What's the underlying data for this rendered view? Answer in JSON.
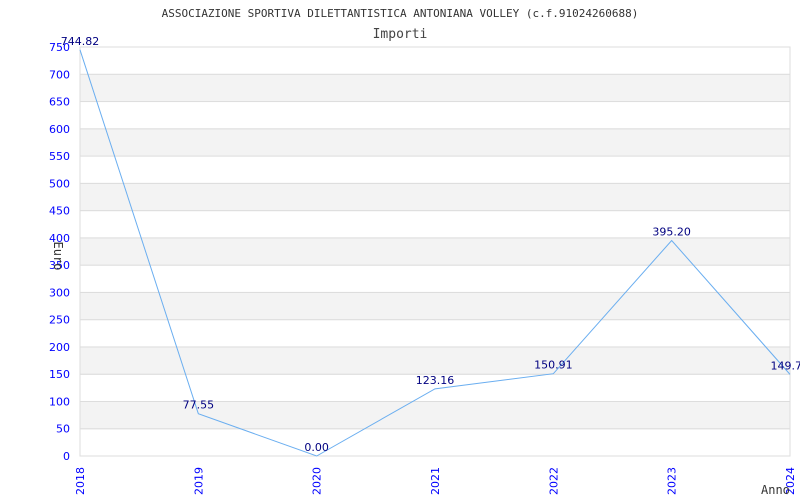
{
  "chart_data": {
    "type": "line",
    "title": "ASSOCIAZIONE SPORTIVA DILETTANTISTICA ANTONIANA VOLLEY (c.f.91024260688)",
    "subtitle": "Importi",
    "xlabel": "Anno",
    "ylabel": "Euro",
    "categories": [
      "2018",
      "2019",
      "2020",
      "2021",
      "2022",
      "2023",
      "2024"
    ],
    "values": [
      744.82,
      77.55,
      0.0,
      123.16,
      150.91,
      395.2,
      149.7
    ],
    "data_labels": [
      "744.82",
      "77.55",
      "0.00",
      "123.16",
      "150.91",
      "395.20",
      "149.7"
    ],
    "ylim": [
      0,
      750
    ],
    "yticks": [
      0,
      50,
      100,
      150,
      200,
      250,
      300,
      350,
      400,
      450,
      500,
      550,
      600,
      650,
      700,
      750
    ],
    "grid": true,
    "colors": {
      "line": "#6aaef0",
      "tick_labels": "#0000ff",
      "data_labels": "#000080",
      "band": "#f3f3f3",
      "grid": "#dddddd"
    }
  }
}
